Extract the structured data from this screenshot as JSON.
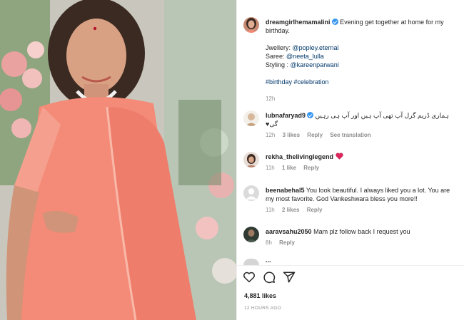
{
  "post": {
    "author": "dreamgirlhemamalini",
    "caption_line1": "Evening get together at home for my birthday.",
    "jewellery_label": "Jwellery:",
    "jewellery_handle": "@popley.eternal",
    "saree_label": "Saree:",
    "saree_handle": "@neeta_lulla",
    "styling_label": "Styling :",
    "styling_handle": "@kareenparwani",
    "hashtags": "#birthday #celebration",
    "time": "12h"
  },
  "comments": [
    {
      "user": "lubnafaryad9",
      "text": "ہماری ڈریم گرل آپ تھی آپ ہیں اور آپ ہی رہیں گی♥",
      "time": "12h",
      "likes": "3 likes",
      "reply": "Reply",
      "extra": "See translation"
    },
    {
      "user": "rekha_thelivinglegend",
      "text": "",
      "time": "11h",
      "likes": "1 like",
      "reply": "Reply"
    },
    {
      "user": "beenabehal5",
      "text": "You look beautiful. I always liked you a lot. You are my most favorite. God Vankeshwara bless you more!!",
      "time": "11h",
      "likes": "2 likes",
      "reply": "Reply"
    },
    {
      "user": "aaravsahu2050",
      "text": "Mam plz follow back I request you",
      "time": "8h",
      "reply": "Reply"
    }
  ],
  "cutoff_user": "...",
  "footer": {
    "likes": "4,881 likes",
    "posted": "12 HOURS AGO"
  },
  "icons": [
    "heart-icon",
    "comment-icon",
    "share-icon",
    "verified-badge-icon"
  ],
  "colors": {
    "link": "#00376b",
    "verified": "#3897f0",
    "muted": "#8e8e8e",
    "saree": "#f38b78"
  }
}
